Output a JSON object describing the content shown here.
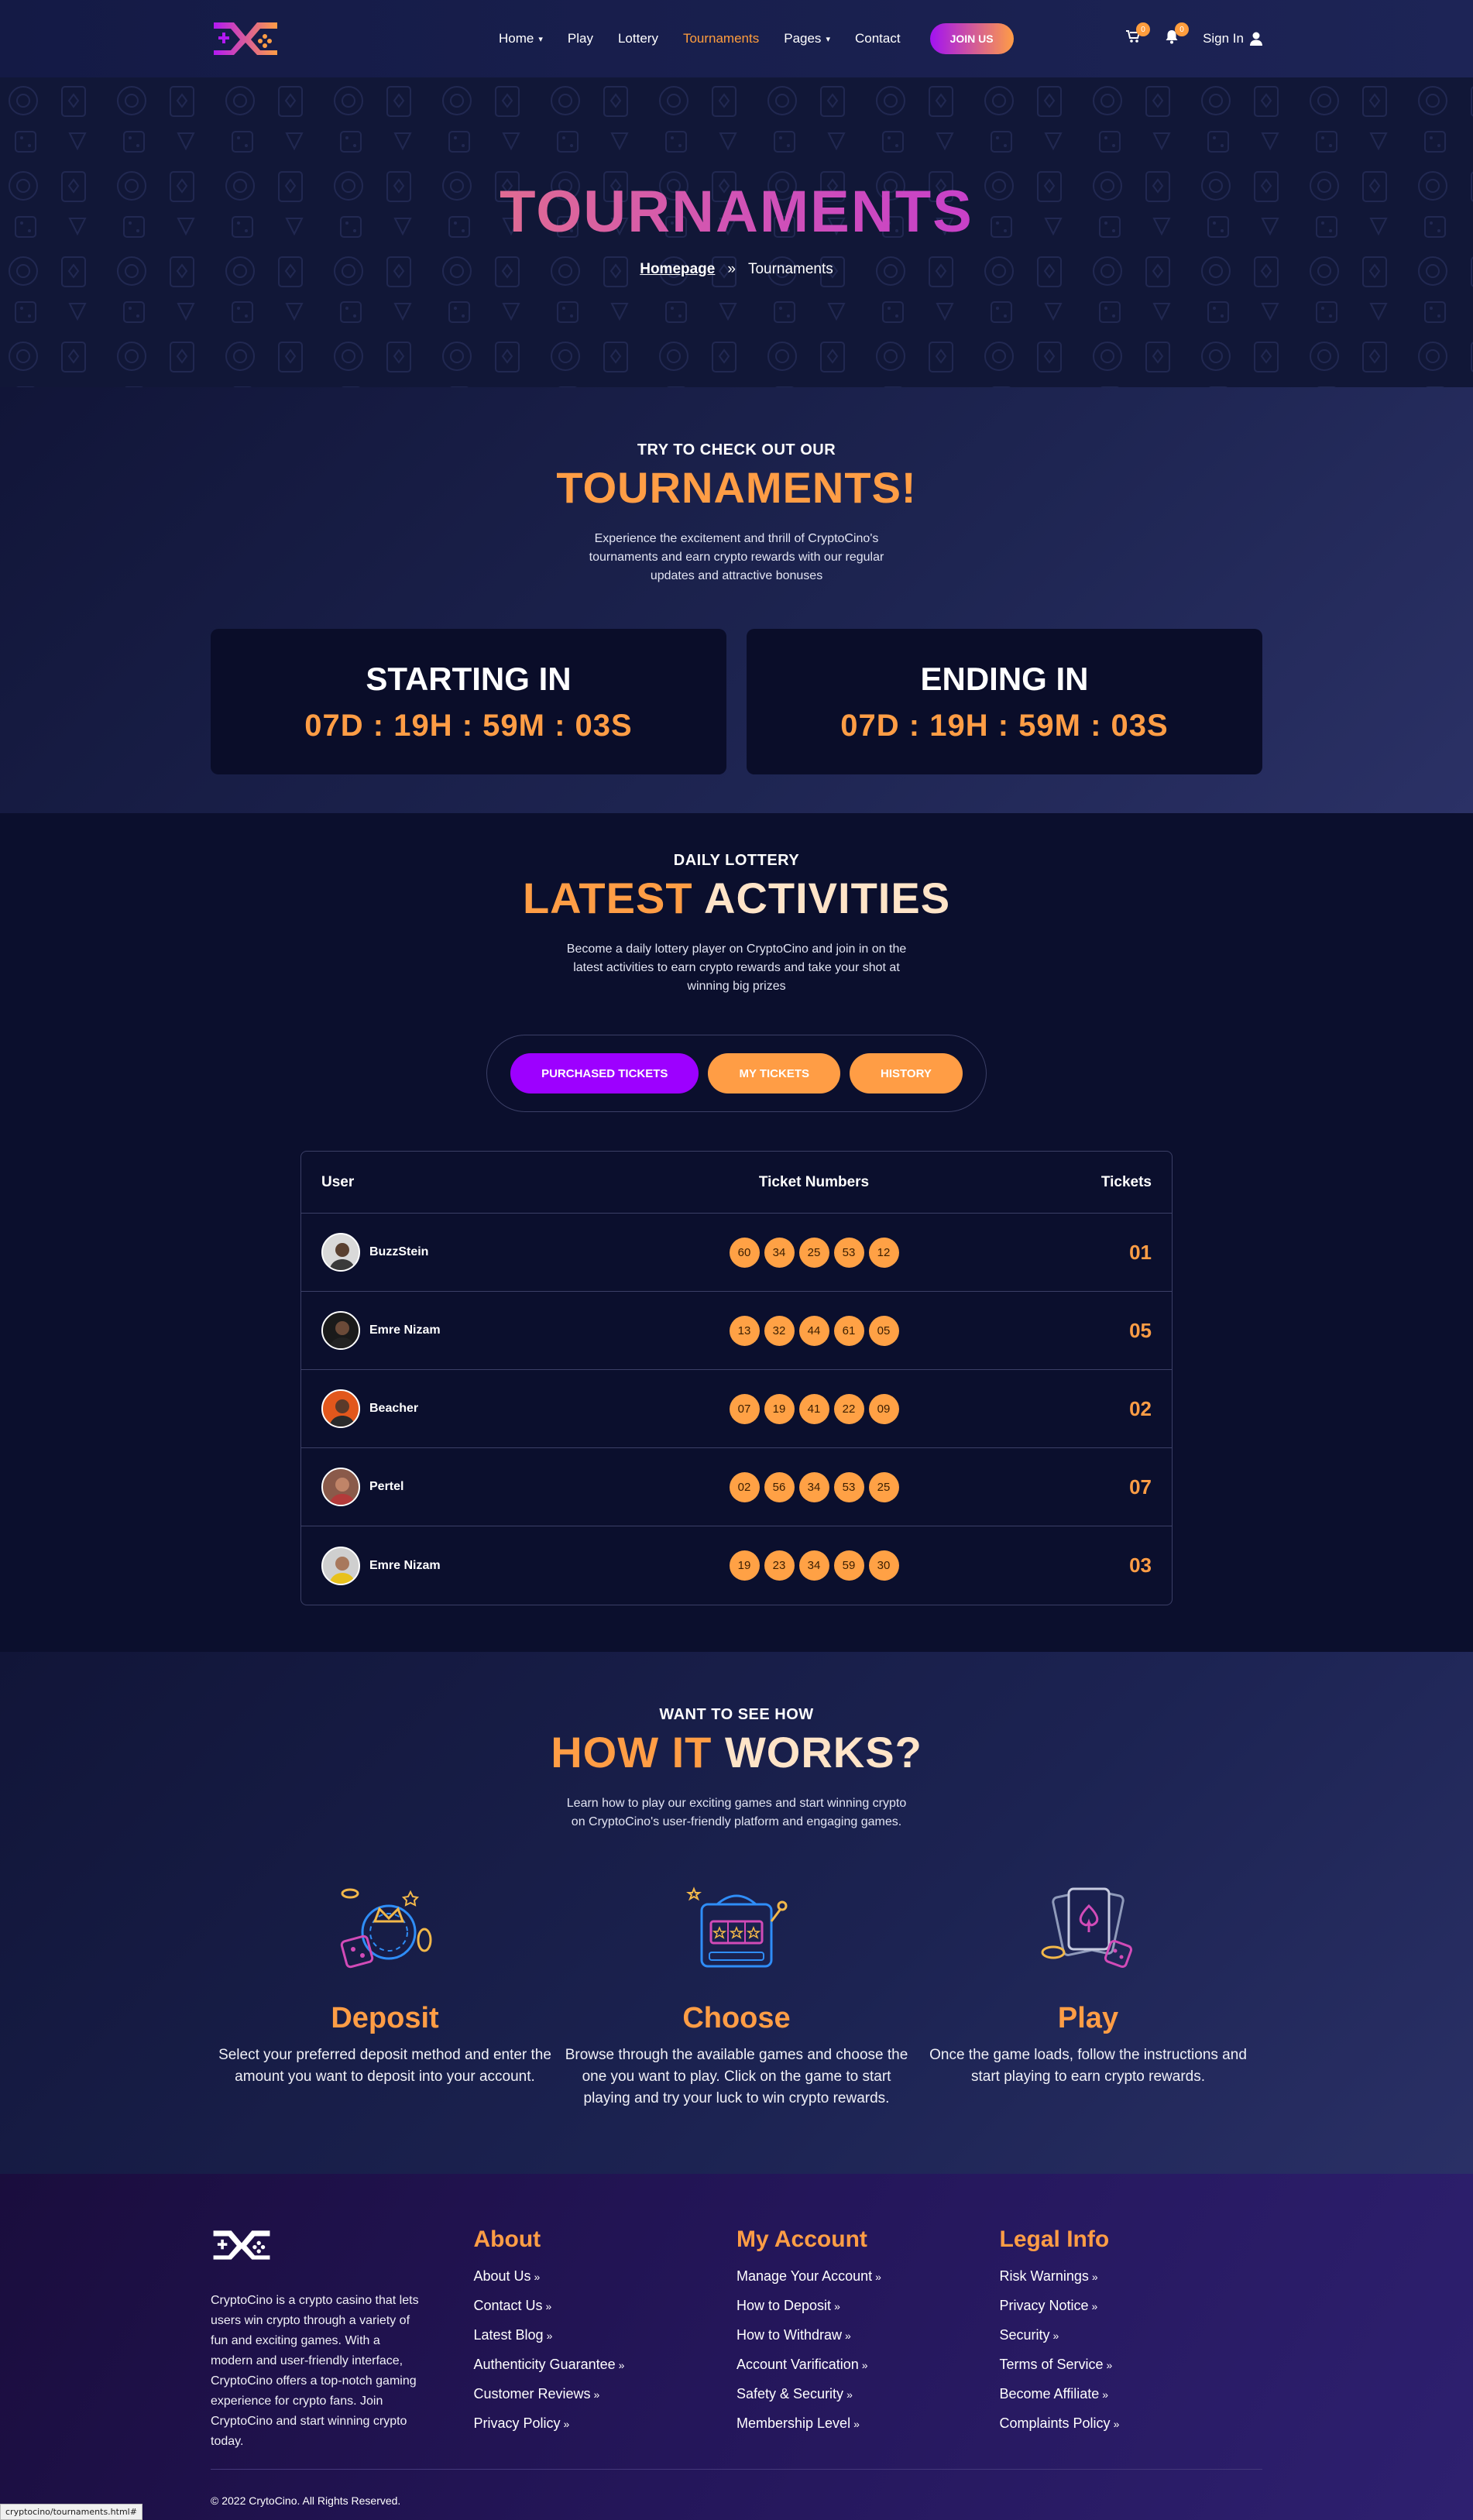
{
  "nav": {
    "links": [
      {
        "label": "Home",
        "has_dropdown": true,
        "active": false
      },
      {
        "label": "Play",
        "has_dropdown": false,
        "active": false
      },
      {
        "label": "Lottery",
        "has_dropdown": false,
        "active": false
      },
      {
        "label": "Tournaments",
        "has_dropdown": false,
        "active": true
      },
      {
        "label": "Pages",
        "has_dropdown": true,
        "active": false
      },
      {
        "label": "Contact",
        "has_dropdown": false,
        "active": false
      }
    ],
    "join_label": "JOIN US",
    "cart_count": "0",
    "notif_count": "0",
    "signin_label": "Sign In",
    "icons": {
      "cart": "cart-icon",
      "bell": "bell-icon",
      "user": "user-icon",
      "chevron": "chevron-down-icon"
    }
  },
  "hero": {
    "title": "TOURNAMENTS",
    "crumb_home": "Homepage",
    "crumb_sep": "»",
    "crumb_current": "Tournaments"
  },
  "tournament": {
    "eyebrow": "TRY TO CHECK OUT OUR",
    "title": "TOURNAMENTS!",
    "description": "Experience the excitement and thrill of CryptoCino's tournaments and earn crypto rewards with our regular updates and attractive bonuses",
    "starting_label": "STARTING IN",
    "starting_time": "07D : 19H : 59M : 03S",
    "ending_label": "ENDING IN",
    "ending_time": "07D : 19H : 59M : 03S"
  },
  "lottery": {
    "eyebrow": "DAILY LOTTERY",
    "title_a": "LATEST",
    "title_b": "ACTIVITIES",
    "description": "Become a daily lottery player on CryptoCino and join in on the latest activities to earn crypto rewards and take your shot at winning big prizes",
    "tabs": [
      "PURCHASED TICKETS",
      "MY TICKETS",
      "HISTORY"
    ],
    "columns": {
      "user": "User",
      "numbers": "Ticket Numbers",
      "tickets": "Tickets"
    },
    "rows": [
      {
        "user": "BuzzStein",
        "numbers": [
          "60",
          "34",
          "25",
          "53",
          "12"
        ],
        "tickets": "01"
      },
      {
        "user": "Emre Nizam",
        "numbers": [
          "13",
          "32",
          "44",
          "61",
          "05"
        ],
        "tickets": "05"
      },
      {
        "user": "Beacher",
        "numbers": [
          "07",
          "19",
          "41",
          "22",
          "09"
        ],
        "tickets": "02"
      },
      {
        "user": "Pertel",
        "numbers": [
          "02",
          "56",
          "34",
          "53",
          "25"
        ],
        "tickets": "07"
      },
      {
        "user": "Emre Nizam",
        "numbers": [
          "19",
          "23",
          "34",
          "59",
          "30"
        ],
        "tickets": "03"
      }
    ]
  },
  "how": {
    "eyebrow": "WANT TO SEE HOW",
    "title_a": "HOW IT",
    "title_b": "WORKS?",
    "description": "Learn how to play our exciting games and start winning crypto on CryptoCino's user-friendly platform and engaging games.",
    "steps": [
      {
        "title": "Deposit",
        "description": "Select your preferred deposit method and enter the amount you want to deposit into your account.",
        "icon": "deposit-chips-icon"
      },
      {
        "title": "Choose",
        "description": "Browse through the available games and choose the one you want to play. Click on the game to start playing and try your luck to win crypto rewards.",
        "icon": "slot-machine-icon"
      },
      {
        "title": "Play",
        "description": "Once the game loads, follow the instructions and start playing to earn crypto rewards.",
        "icon": "cards-dice-icon"
      }
    ]
  },
  "footer": {
    "about_text": "CryptoCino is a crypto casino that lets users win crypto through a variety of fun and exciting games. With a modern and user-friendly interface, CryptoCino offers a top-notch gaming experience for crypto fans. Join CryptoCino and start winning crypto today.",
    "columns": [
      {
        "heading": "About",
        "links": [
          "About Us",
          "Contact Us",
          "Latest Blog",
          "Authenticity Guarantee",
          "Customer Reviews",
          "Privacy Policy"
        ]
      },
      {
        "heading": "My Account",
        "links": [
          "Manage Your Account",
          "How to Deposit",
          "How to Withdraw",
          "Account Varification",
          "Safety & Security",
          "Membership Level"
        ]
      },
      {
        "heading": "Legal Info",
        "links": [
          "Risk Warnings",
          "Privacy Notice",
          "Security",
          "Terms of Service",
          "Become Affiliate",
          "Complaints Policy"
        ]
      }
    ],
    "link_arrow": "»",
    "copyright": "© 2022 CrytoCino. All Rights Reserved."
  },
  "status_url": "cryptocino/tournaments.html#",
  "colors": {
    "accent": "#ff9d45",
    "purple": "#9d00ff",
    "bg": "#0b0f2e"
  }
}
